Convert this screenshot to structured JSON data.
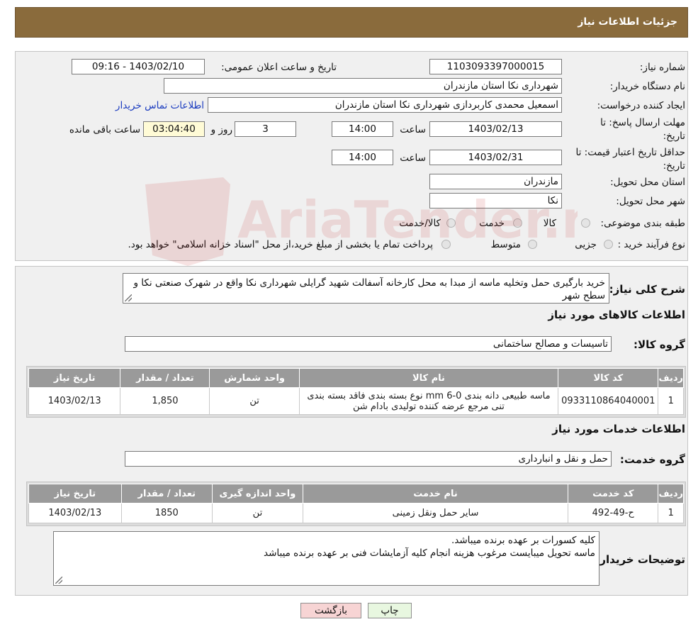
{
  "header": {
    "title": "جزئیات اطلاعات نیاز"
  },
  "form": {
    "need_number_label": "شماره نیاز:",
    "need_number": "1103093397000015",
    "announce_label": "تاریخ و ساعت اعلان عمومی:",
    "announce_value": "1403/02/10 - 09:16",
    "buyer_org_label": "نام دستگاه خریدار:",
    "buyer_org": "شهرداری نکا استان مازندران",
    "creator_label": "ایجاد کننده درخواست:",
    "creator": "اسمعیل محمدی کاربردازی شهرداری نکا استان مازندران",
    "contact_link": "اطلاعات تماس خریدار",
    "deadline_label_1": "مهلت ارسال پاسخ: تا",
    "deadline_label_2": "تاریخ:",
    "deadline_date": "1403/02/13",
    "time_word": "ساعت",
    "deadline_time": "14:00",
    "remaining_days": "3",
    "days_and": "روز و",
    "remaining_time": "03:04:40",
    "remaining_label": "ساعت باقی مانده",
    "validity_label_1": "حداقل تاریخ اعتبار قیمت: تا",
    "validity_label_2": "تاریخ:",
    "validity_date": "1403/02/31",
    "validity_time": "14:00",
    "province_label": "استان محل تحویل:",
    "province": "مازندران",
    "city_label": "شهر محل تحویل:",
    "city": "نکا",
    "category_label": "طبقه بندی موضوعی:",
    "category_options": [
      "کالا",
      "خدمت",
      "کالا/خدمت"
    ],
    "process_label": "نوع فرآیند خرید :",
    "process_options": [
      "جزیی",
      "متوسط"
    ],
    "process_note": "پرداخت تمام یا بخشی از مبلغ خرید،از محل \"اسناد خزانه اسلامی\" خواهد بود."
  },
  "details": {
    "summary_label": "شرح کلی نیاز:",
    "summary": "خرید بارگیری حمل وتخلیه ماسه از مبدا به محل کارخانه آسفالت شهید گرایلی شهرداری نکا واقع در شهرک صنعتی نکا و سطح شهر",
    "goods_title": "اطلاعات کالاهای مورد نیاز",
    "goods_group_label": "گروه کالا:",
    "goods_group": "تاسیسات و مصالح ساختمانی",
    "goods_table": {
      "headers": [
        "ردیف",
        "کد کالا",
        "نام کالا",
        "واحد شمارش",
        "تعداد / مقدار",
        "تاریخ نیاز"
      ],
      "rows": [
        [
          "1",
          "0933110864040001",
          "ماسه طبیعی دانه بندی mm 6-0 نوع بسته بندی فاقد بسته بندی تنی مرجع عرضه کننده تولیدی بادام شن",
          "تن",
          "1,850",
          "1403/02/13"
        ]
      ]
    },
    "services_title": "اطلاعات خدمات مورد نیاز",
    "service_group_label": "گروه خدمت:",
    "service_group": "حمل و نقل و انبارداری",
    "services_table": {
      "headers": [
        "ردیف",
        "کد خدمت",
        "نام خدمت",
        "واحد اندازه گیری",
        "تعداد / مقدار",
        "تاریخ نیاز"
      ],
      "rows": [
        [
          "1",
          "ح-49-492",
          "سایر حمل ونقل زمینی",
          "تن",
          "1850",
          "1403/02/13"
        ]
      ]
    },
    "buyer_notes_label": "توضیحات خریدار:",
    "buyer_notes_line1": "کلیه کسورات بر عهده برنده میباشد.",
    "buyer_notes_line2": "ماسه تحویل میبایست مرغوب هزینه انجام کلیه آزمایشات فنی بر عهده برنده میباشد"
  },
  "buttons": {
    "print": "چاپ",
    "back": "بازگشت"
  },
  "watermark": {
    "text": "AriaTender.neT"
  },
  "colors": {
    "header": "#8a6b3c",
    "link": "#1a3bbf",
    "back_button": "#f7d4d4",
    "print_button": "#e8f7e0"
  }
}
